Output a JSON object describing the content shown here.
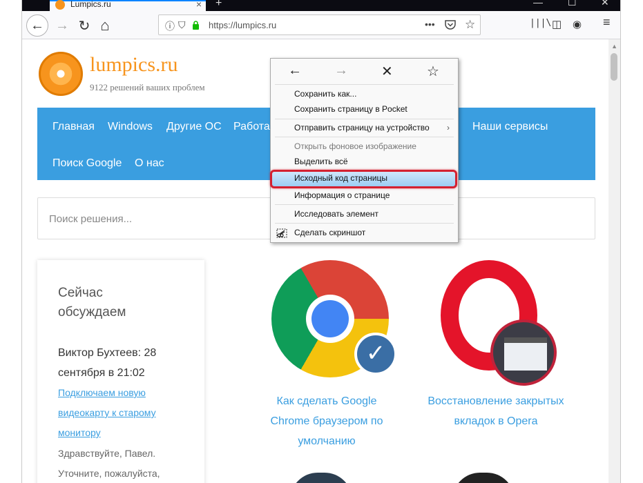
{
  "browser": {
    "tab_title": "Lumpics.ru",
    "tab_close": "×",
    "new_tab": "+",
    "minimize": "—",
    "maximize": "☐",
    "close": "✕",
    "url": "https://lumpics.ru",
    "icons": {
      "back": "back-arrow-icon",
      "forward": "forward-arrow-icon",
      "reload": "reload-icon",
      "home": "home-icon",
      "info": "info-icon",
      "shield": "tracking-shield-icon",
      "lock": "lock-icon",
      "more": "more-dots-icon",
      "pocket": "pocket-icon",
      "bookmark": "bookmark-star-icon",
      "library": "library-icon",
      "sidebar": "sidebar-icon",
      "account": "account-icon",
      "menu": "hamburger-menu-icon"
    },
    "glyphs": {
      "back": "←",
      "forward": "→",
      "reload": "↻",
      "home": "⌂",
      "info": "ⓘ",
      "shield": "⛉",
      "lock": "🔒",
      "more": "•••",
      "pocket": "◡",
      "bookmark": "☆",
      "library": "|||\\",
      "sidebar": "◫",
      "account": "◉",
      "menu": "≡"
    }
  },
  "site": {
    "title": "lumpics.ru",
    "subtitle": "9122 решений ваших проблем",
    "brand_color": "#f7941d",
    "nav_color": "#3a9ee0",
    "nav": {
      "row1": [
        "Главная",
        "Windows",
        "Другие ОС",
        "Работа"
      ],
      "row1_right": "Наши сервисы",
      "row2": [
        "Поиск Google",
        "О нас"
      ]
    },
    "search_placeholder": "Поиск решения...",
    "sidebar": {
      "heading": "Сейчас обсуждаем",
      "author": "Виктор Бухтеев: 28 сентября в 21:02",
      "link": "Подключаем новую видеокарту к старому монитору",
      "comment": "Здравствуйте, Павел. Уточните, пожалуйста,"
    },
    "articles": [
      {
        "title": "Как сделать Google Chrome браузером по умолчанию",
        "icon": "chrome-logo-icon"
      },
      {
        "title": "Восстановление закрытых вкладок в Opera",
        "icon": "opera-logo-icon"
      }
    ]
  },
  "context_menu": {
    "nav_glyphs": {
      "back": "←",
      "forward": "→",
      "stop": "✕",
      "bookmark": "☆"
    },
    "items": [
      {
        "label": "Сохранить как...",
        "disabled": false
      },
      {
        "label": "Сохранить страницу в Pocket",
        "disabled": false
      },
      {
        "label": "Отправить страницу на устройство",
        "disabled": false,
        "submenu": "›"
      },
      {
        "label": "Открыть фоновое изображение",
        "disabled": true
      },
      {
        "label": "Выделить всё",
        "disabled": false
      },
      {
        "label": "Исходный код страницы",
        "disabled": false,
        "highlighted": true
      },
      {
        "label": "Информация о странице",
        "disabled": false
      },
      {
        "label": "Исследовать элемент",
        "disabled": false
      },
      {
        "label": "Сделать скриншот",
        "disabled": false,
        "icon": "screenshot-scissors-icon"
      }
    ],
    "highlight_color": "#d42030"
  }
}
